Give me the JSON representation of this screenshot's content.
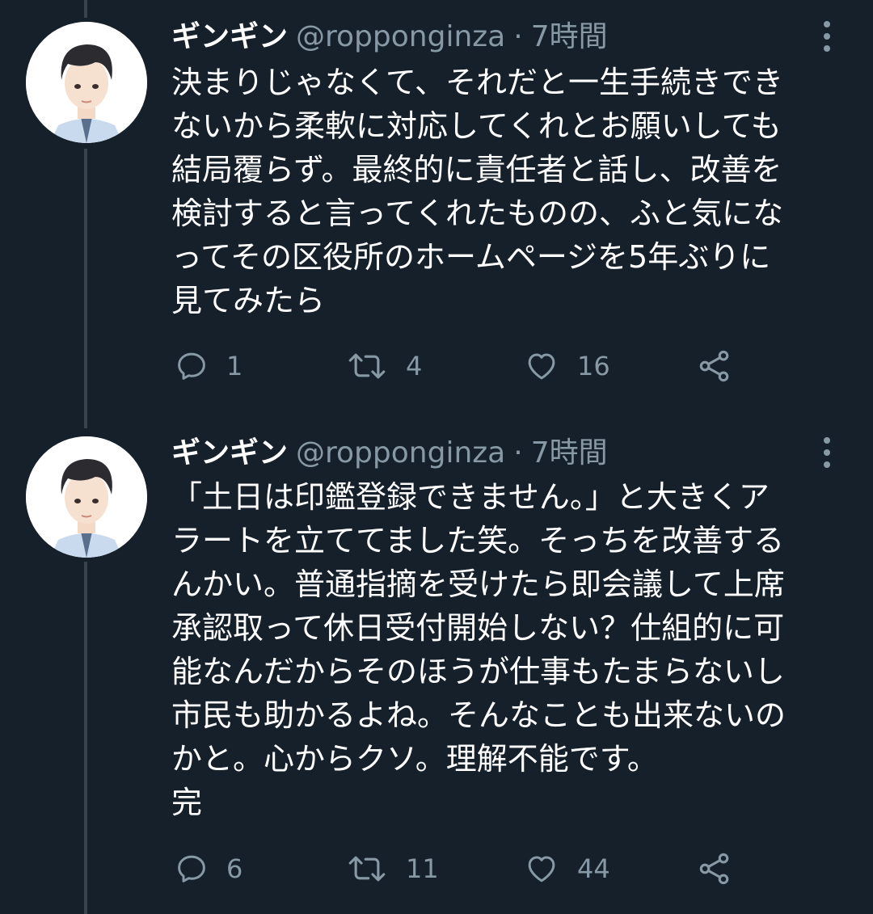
{
  "tweets": [
    {
      "display_name": "ギンギン",
      "handle": "@ropponginza",
      "separator": "·",
      "time": "7時間",
      "lines": [
        "決まりじゃなくて、それだと一生手続きでき",
        "ないから柔軟に対応してくれとお願いしても",
        "結局覆らず。最終的に責任者と話し、改善を",
        "検討すると言ってくれたものの、ふと気にな",
        "ってその区役所のホームページを5年ぶりに",
        "見てみたら"
      ],
      "replies": "1",
      "retweets": "4",
      "likes": "16"
    },
    {
      "display_name": "ギンギン",
      "handle": "@ropponginza",
      "separator": "·",
      "time": "7時間",
      "lines": [
        "「土日は印鑑登録できません。」と大きくア",
        "ラートを立ててました笑。そっちを改善する",
        "んかい。普通指摘を受けたら即会議して上席",
        "承認取って休日受付開始しない？仕組的に可",
        "能なんだからそのほうが仕事もたまらないし",
        "市民も助かるよね。そんなことも出来ないの",
        "かと。心からクソ。理解不能です。",
        "完"
      ],
      "replies": "6",
      "retweets": "11",
      "likes": "44"
    }
  ],
  "icons": [
    "reply-icon",
    "retweet-icon",
    "like-icon",
    "share-icon",
    "more-icon"
  ],
  "colors": {
    "background": "#15202b",
    "text": "#ffffff",
    "secondary": "#8899a6",
    "thread_line": "#38444d"
  }
}
